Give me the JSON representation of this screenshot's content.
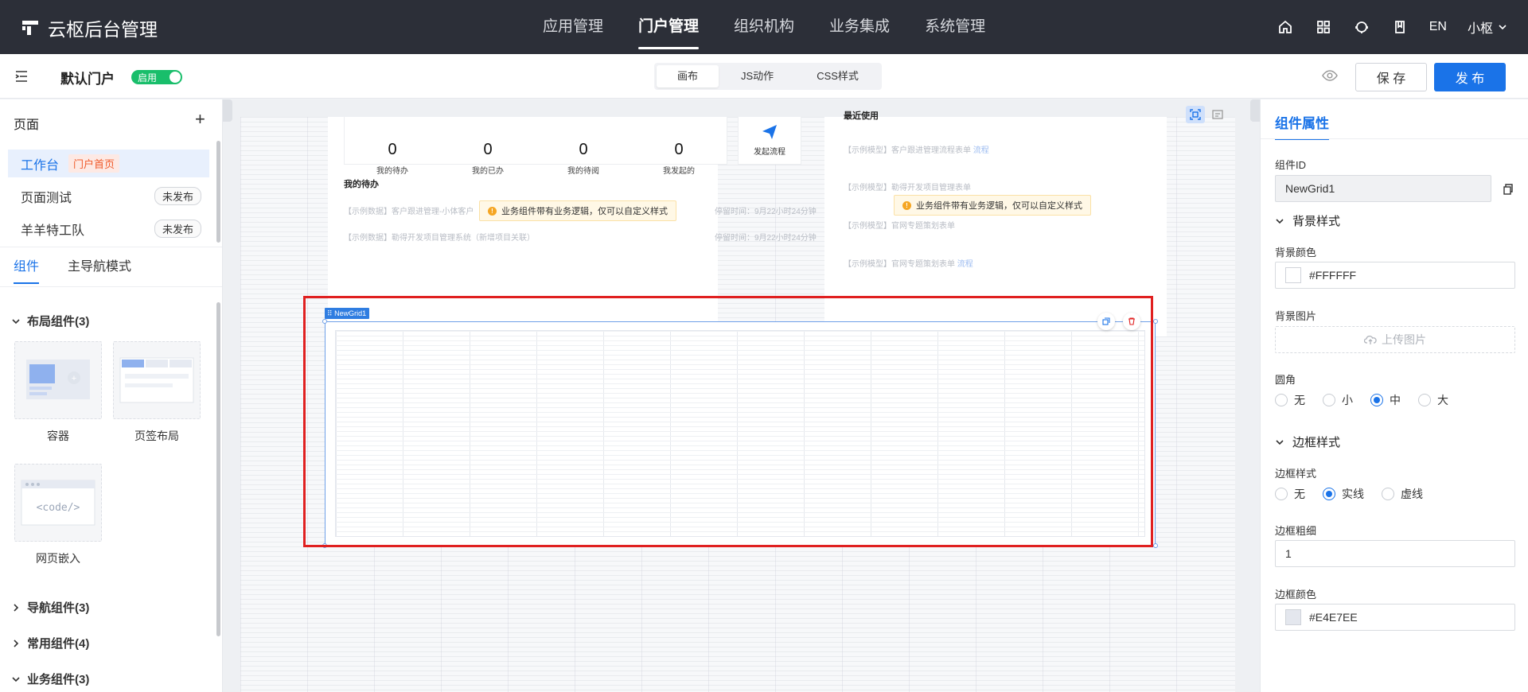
{
  "app": {
    "title": "云枢后台管理"
  },
  "topnav": {
    "items": [
      "应用管理",
      "门户管理",
      "组织机构",
      "业务集成",
      "系统管理"
    ],
    "active": "门户管理",
    "lang": "EN",
    "user": "小枢"
  },
  "subbar": {
    "portal_name": "默认门户",
    "status": "启用",
    "tabs": [
      "画布",
      "JS动作",
      "CSS样式"
    ],
    "active_tab": "画布",
    "save": "保 存",
    "publish": "发 布"
  },
  "left": {
    "pages_title": "页面",
    "pages": [
      {
        "name": "工作台",
        "tag": "门户首页"
      },
      {
        "name": "页面测试",
        "tag": "未发布"
      },
      {
        "name": "羊羊特工队",
        "tag": "未发布"
      }
    ],
    "tabs": [
      "组件",
      "主导航模式"
    ],
    "groups": {
      "layout": "布局组件(3)",
      "nav": "导航组件(3)",
      "common": "常用组件(4)",
      "business": "业务组件(3)"
    },
    "components": [
      "容器",
      "页签布局",
      "网页嵌入"
    ],
    "code_label": "<code/>"
  },
  "canvas": {
    "stats": [
      {
        "n": "0",
        "l": "我的待办"
      },
      {
        "n": "0",
        "l": "我的已办"
      },
      {
        "n": "0",
        "l": "我的待阅"
      },
      {
        "n": "0",
        "l": "我发起的"
      }
    ],
    "launch": "发起流程",
    "todo_title": "我的待办",
    "todo_rows": [
      {
        "text": "【示例数据】客户跟进管理-小体客户",
        "time": "停留时间：9月22小时24分钟"
      },
      {
        "text": "【示例数据】勒得开发项目管理系统（新增项目关联）",
        "time": "停留时间：9月22小时24分钟"
      }
    ],
    "recent_title": "最近使用",
    "recent_rows": [
      {
        "text": "【示例模型】客户跟进管理流程表单",
        "tag": "流程"
      },
      {
        "text": "【示例模型】勒得开发项目管理表单",
        "tag": ""
      },
      {
        "text": "【示例模型】官网专题策划表单",
        "tag": ""
      },
      {
        "text": "【示例模型】官网专题策划表单",
        "tag": "流程"
      }
    ],
    "warning": "业务组件带有业务逻辑，仅可以自定义样式",
    "grid_tag": "NewGrid1"
  },
  "right": {
    "title": "组件属性",
    "id_label": "组件ID",
    "id_value": "NewGrid1",
    "bg_section": "背景样式",
    "bg_color_label": "背景颜色",
    "bg_color": "#FFFFFF",
    "bg_image_label": "背景图片",
    "upload": "上传图片",
    "radius_label": "圆角",
    "radius_options": [
      "无",
      "小",
      "中",
      "大"
    ],
    "radius_selected": "中",
    "border_section": "边框样式",
    "border_style_label": "边框样式",
    "border_options": [
      "无",
      "实线",
      "虚线"
    ],
    "border_selected": "实线",
    "border_width_label": "边框粗细",
    "border_width": "1",
    "border_color_label": "边框颜色",
    "border_color": "#E4E7EE"
  },
  "colors": {
    "accent": "#1a73e8",
    "nav_bg": "#2c2f38",
    "highlight": "#e02020",
    "success": "#19be6b"
  }
}
